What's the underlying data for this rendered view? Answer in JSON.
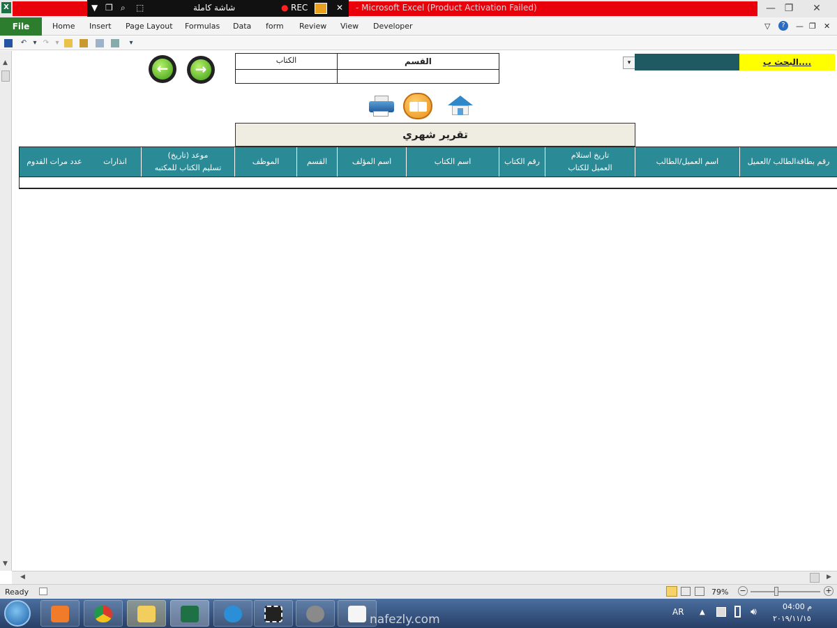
{
  "window": {
    "title": "Microsoft Excel (Product Activation Failed)",
    "title_prefix": "-",
    "recorder": {
      "mode_label": "شاشة كاملة",
      "rec_label": "REC"
    }
  },
  "ribbon": {
    "file_label": "File",
    "tabs": [
      "Home",
      "Insert",
      "Page Layout",
      "Formulas",
      "Data",
      "form",
      "Review",
      "View",
      "Developer"
    ]
  },
  "filter": {
    "label_book": "الكتاب",
    "label_section": "القسم"
  },
  "search": {
    "label": "البحث ب....",
    "accent": "#ffff00",
    "dark": "#1f5a63"
  },
  "report": {
    "title": "تقرير  شهري",
    "columns": [
      "رقم بطاقةالطالب /العميل",
      "اسم العميل/الطالب",
      "تاريخ استلام\nالعميل للكتاب",
      "رقم الكتاب",
      "اسم الكتاب",
      "اسم المؤلف",
      "القسم",
      "الموظف",
      "موعد (تاريخ)\nتسليم الكتاب للمكتبه",
      "انذارات",
      "عدد مرات القدوم"
    ],
    "header_color": "#2a8a96"
  },
  "status": {
    "ready": "Ready",
    "zoom": "79%"
  },
  "taskbar": {
    "lang": "AR",
    "time": "04:00 م",
    "date": "٢٠١٩/١١/١٥",
    "watermark": "nafezly.com"
  },
  "icons": [
    "excel-logo-icon",
    "back-arrow-icon",
    "forward-arrow-icon",
    "printer-icon",
    "book-icon",
    "home-icon",
    "dropdown-icon",
    "start-orb-icon",
    "chrome-icon",
    "explorer-icon",
    "ie-icon"
  ]
}
